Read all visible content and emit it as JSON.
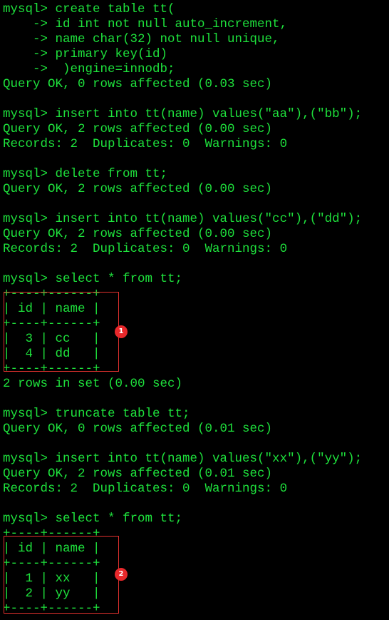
{
  "terminal": {
    "lines": [
      "mysql> create table tt(",
      "    -> id int not null auto_increment,",
      "    -> name char(32) not null unique,",
      "    -> primary key(id)",
      "    ->  )engine=innodb;",
      "Query OK, 0 rows affected (0.03 sec)",
      "",
      "mysql> insert into tt(name) values(\"aa\"),(\"bb\");",
      "Query OK, 2 rows affected (0.00 sec)",
      "Records: 2  Duplicates: 0  Warnings: 0",
      "",
      "mysql> delete from tt;",
      "Query OK, 2 rows affected (0.00 sec)",
      "",
      "mysql> insert into tt(name) values(\"cc\"),(\"dd\");",
      "Query OK, 2 rows affected (0.00 sec)",
      "Records: 2  Duplicates: 0  Warnings: 0",
      "",
      "mysql> select * from tt;",
      "+----+------+",
      "| id | name |",
      "+----+------+",
      "|  3 | cc   |",
      "|  4 | dd   |",
      "+----+------+",
      "2 rows in set (0.00 sec)",
      "",
      "mysql> truncate table tt;",
      "Query OK, 0 rows affected (0.01 sec)",
      "",
      "mysql> insert into tt(name) values(\"xx\"),(\"yy\");",
      "Query OK, 2 rows affected (0.01 sec)",
      "Records: 2  Duplicates: 0  Warnings: 0",
      "",
      "mysql> select * from tt;",
      "+----+------+",
      "| id | name |",
      "+----+------+",
      "|  1 | xx   |",
      "|  2 | yy   |",
      "+----+------+"
    ]
  },
  "annotations": [
    {
      "badge": "1"
    },
    {
      "badge": "2"
    }
  ],
  "colors": {
    "background": "#000000",
    "text": "#1ee13c",
    "annotation": "#e8282b"
  }
}
